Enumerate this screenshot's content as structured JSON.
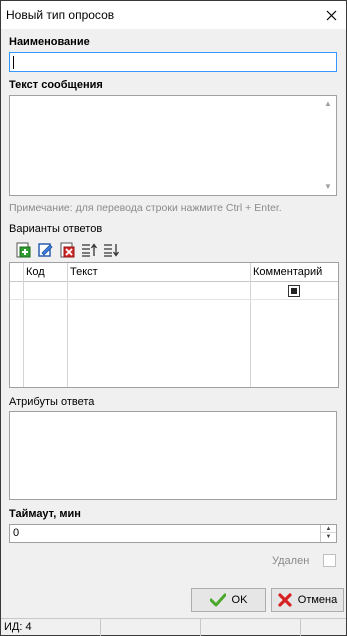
{
  "window": {
    "title": "Новый тип опросов"
  },
  "form": {
    "name_label": "Наименование",
    "name_value": "",
    "message_label": "Текст сообщения",
    "message_value": "",
    "message_hint": "Примечание: для перевода строки нажмите Ctrl + Enter.",
    "answers_label": "Варианты ответов",
    "answers_toolbar": [
      {
        "icon": "add-icon"
      },
      {
        "icon": "edit-icon"
      },
      {
        "icon": "delete-icon"
      },
      {
        "icon": "move-up-icon"
      },
      {
        "icon": "move-down-icon"
      }
    ],
    "answers_grid": {
      "columns": [
        "Код",
        "Текст",
        "Комментарий"
      ],
      "rows": [
        {
          "code": "",
          "text": "",
          "comment_checked": true
        }
      ]
    },
    "attributes_label": "Атрибуты ответа",
    "timeout_label": "Таймаут, мин",
    "timeout_value": "0",
    "deleted_label": "Удален",
    "deleted_checked": false
  },
  "buttons": {
    "ok_label": "OK",
    "cancel_label": "Отмена"
  },
  "status": {
    "id_text": "ИД: 4"
  }
}
